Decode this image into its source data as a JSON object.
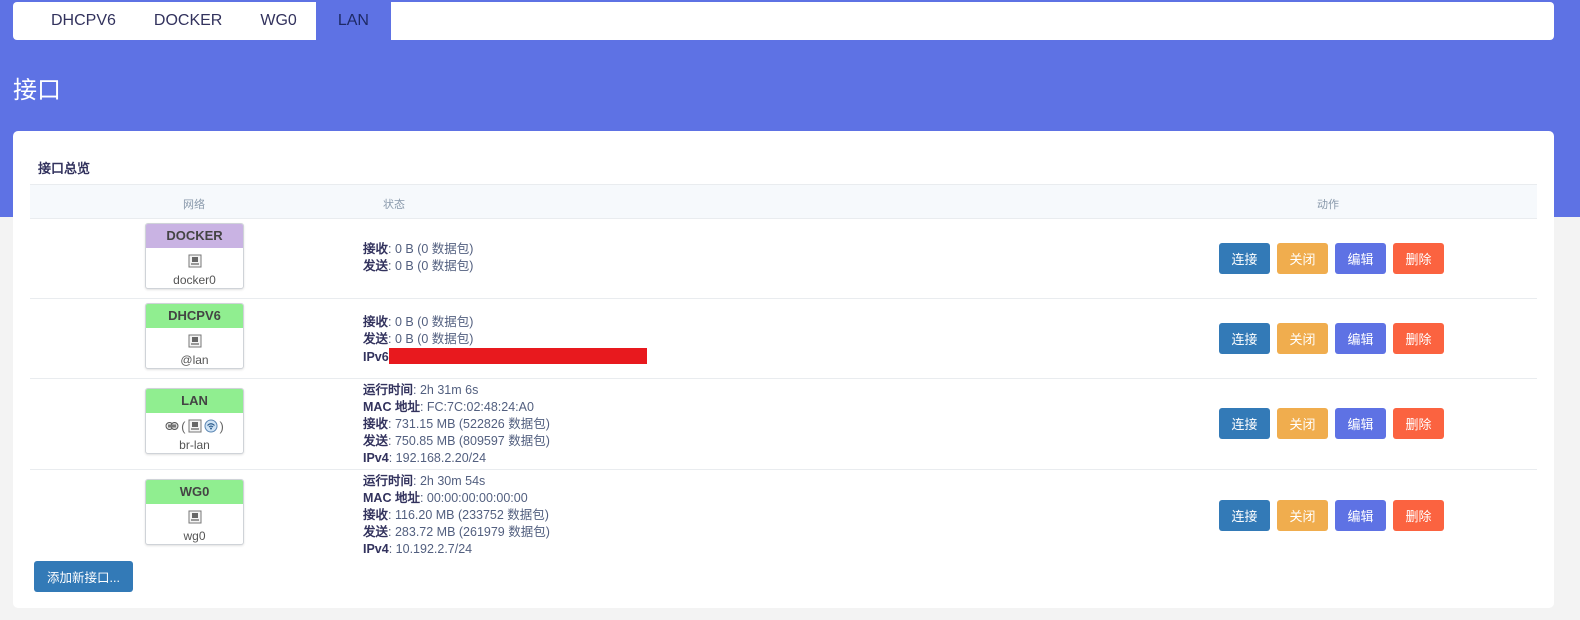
{
  "tabs": [
    {
      "label": "DHCPV6",
      "active": false
    },
    {
      "label": "DOCKER",
      "active": false
    },
    {
      "label": "WG0",
      "active": false
    },
    {
      "label": "LAN",
      "active": true
    }
  ],
  "page_title": "接口",
  "section_title": "接口总览",
  "table": {
    "headers": {
      "network": "网络",
      "status": "状态",
      "actions": "动作"
    },
    "rows": [
      {
        "name": "DOCKER",
        "header_color": "#c9b3e3",
        "device": "docker0",
        "icons": [
          "ethernet-port-icon"
        ],
        "status": [
          {
            "label": "接收",
            "value": ": 0 B (0 数据包)"
          },
          {
            "label": "发送",
            "value": ": 0 B (0 数据包)"
          }
        ]
      },
      {
        "name": "DHCPV6",
        "header_color": "#90ee90",
        "device": "@lan",
        "icons": [
          "ethernet-port-icon"
        ],
        "status": [
          {
            "label": "接收",
            "value": ": 0 B (0 数据包)"
          },
          {
            "label": "发送",
            "value": ": 0 B (0 数据包)"
          },
          {
            "label": "IPv6",
            "value": ""
          }
        ]
      },
      {
        "name": "LAN",
        "header_color": "#90ee90",
        "device": "br-lan",
        "icons": [
          "bridge-icon",
          "ethernet-port-icon",
          "wifi-icon"
        ],
        "status": [
          {
            "label": "运行时间",
            "value": ": 2h 31m 6s"
          },
          {
            "label": "MAC 地址",
            "value": ": FC:7C:02:48:24:A0"
          },
          {
            "label": "接收",
            "value": ": 731.15 MB (522826 数据包)"
          },
          {
            "label": "发送",
            "value": ": 750.85 MB (809597 数据包)"
          },
          {
            "label": "IPv4",
            "value": ": 192.168.2.20/24"
          }
        ]
      },
      {
        "name": "WG0",
        "header_color": "#90ee90",
        "device": "wg0",
        "icons": [
          "ethernet-port-icon"
        ],
        "status": [
          {
            "label": "运行时间",
            "value": ": 2h 30m 54s"
          },
          {
            "label": "MAC 地址",
            "value": ": 00:00:00:00:00:00"
          },
          {
            "label": "接收",
            "value": ": 116.20 MB (233752 数据包)"
          },
          {
            "label": "发送",
            "value": ": 283.72 MB (261979 数据包)"
          },
          {
            "label": "IPv4",
            "value": ": 10.192.2.7/24"
          }
        ]
      }
    ],
    "action_labels": {
      "connect": "连接",
      "stop": "关闭",
      "edit": "编辑",
      "delete": "删除"
    }
  },
  "add_button_label": "添加新接口...",
  "colors": {
    "hero": "#5e72e4",
    "connect": "#337ab7",
    "stop": "#f0ad4e",
    "edit": "#5e72e4",
    "delete": "#fb6340",
    "redaction": "#e8191e"
  }
}
